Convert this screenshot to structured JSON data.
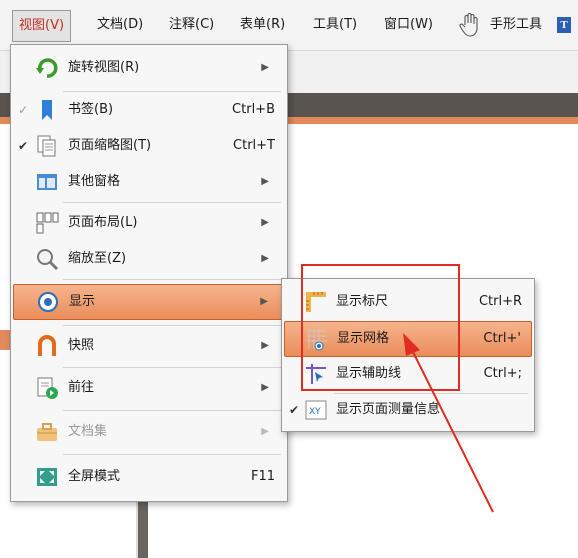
{
  "menubar": {
    "items": [
      {
        "label": "视图(V)"
      },
      {
        "label": "文档(D)"
      },
      {
        "label": "注释(C)"
      },
      {
        "label": "表单(R)"
      },
      {
        "label": "工具(T)"
      },
      {
        "label": "窗口(W)"
      },
      {
        "label": "手形工具"
      }
    ]
  },
  "view_menu": {
    "items": [
      {
        "label": "旋转视图(R)"
      },
      {
        "label": "书签(B)",
        "shortcut": "Ctrl+B"
      },
      {
        "label": "页面缩略图(T)",
        "shortcut": "Ctrl+T"
      },
      {
        "label": "其他窗格"
      },
      {
        "label": "页面布局(L)"
      },
      {
        "label": "缩放至(Z)"
      },
      {
        "label": "显示"
      },
      {
        "label": "快照"
      },
      {
        "label": "前往"
      },
      {
        "label": "文档集"
      },
      {
        "label": "全屏模式",
        "shortcut": "F11"
      }
    ]
  },
  "display_submenu": {
    "items": [
      {
        "label": "显示标尺",
        "shortcut": "Ctrl+R"
      },
      {
        "label": "显示网格",
        "shortcut": "Ctrl+'"
      },
      {
        "label": "显示辅助线",
        "shortcut": "Ctrl+;"
      },
      {
        "label": "显示页面测量信息"
      }
    ]
  },
  "colors": {
    "highlight": "#ea8d5b",
    "annotation_red": "#e02c22",
    "app_dark": "#5a5450",
    "app_orange": "#e28a5c"
  }
}
